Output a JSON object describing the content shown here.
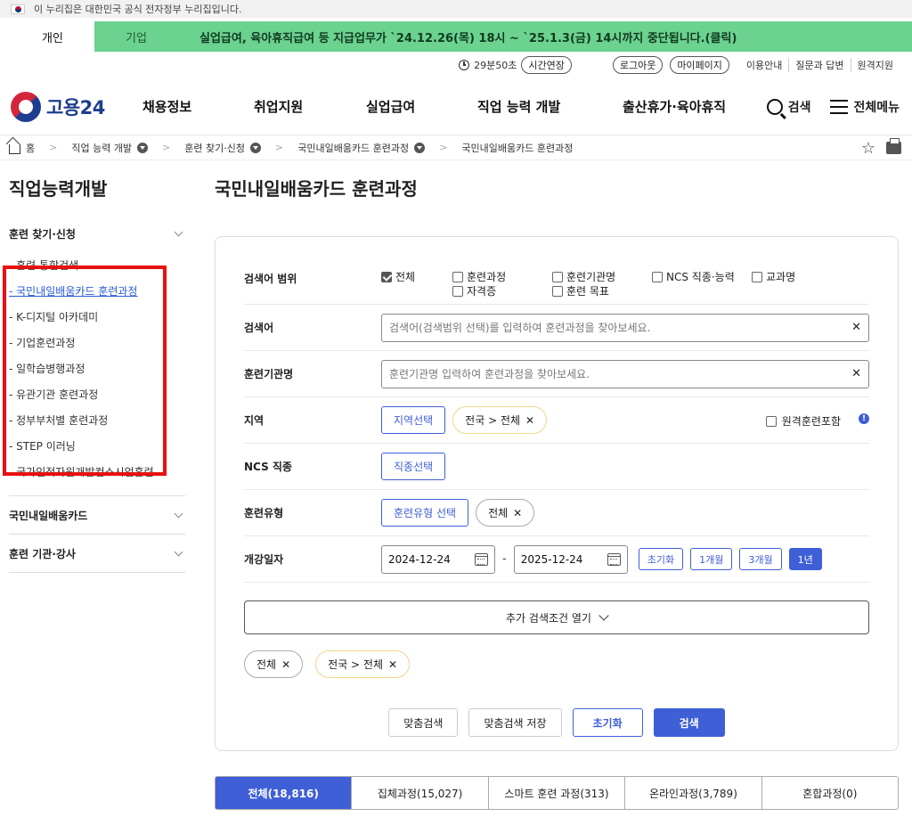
{
  "gov_banner": "이 누리집은 대한민국 공식 전자정부 누리집입니다.",
  "topbar": {
    "tabs": [
      "개인",
      "기업"
    ],
    "notice": "실업급여, 육아휴직급여 등 지급업무가 `24.12.26(목) 18시 ~ `25.1.3(금) 14시까지 중단됩니다.(클릭)"
  },
  "utility": {
    "timer": "29분50초",
    "extend": "시간연장",
    "logout": "로그아웃",
    "mypage": "마이페이지",
    "links": [
      "이용안내",
      "질문과 답변",
      "원격지원"
    ]
  },
  "gnb": {
    "logo": "고용24",
    "menu": [
      "채용정보",
      "취업지원",
      "실업급여",
      "직업 능력 개발",
      "출산휴가·육아휴직"
    ],
    "search": "검색",
    "all_menu": "전체메뉴"
  },
  "breadcrumb": {
    "home": "홈",
    "items": [
      "직업 능력 개발",
      "훈련 찾기·신청",
      "국민내일배움카드 훈련과정",
      "국민내일배움카드 훈련과정"
    ]
  },
  "sidebar": {
    "title": "직업능력개발",
    "group1": {
      "title": "훈련 찾기·신청",
      "items": [
        "- 훈련 통합검색",
        "- 국민내일배움카드 훈련과정",
        "- K-디지털 아카데미",
        "- 기업훈련과정",
        "- 일학습병행과정",
        "- 유관기관 훈련과정",
        "- 정부부처별 훈련과정",
        "- STEP 이러닝",
        "- 국가인적자원개발컨소시엄훈련"
      ]
    },
    "group2": "국민내일배움카드",
    "group3": "훈련 기관·강사"
  },
  "main": {
    "title": "국민내일배움카드 훈련과정",
    "scope": {
      "label": "검색어 범위",
      "options": [
        "전체",
        "훈련과정",
        "훈련기관명",
        "NCS 직종·능력",
        "교과명",
        "자격증",
        "훈련 목표"
      ]
    },
    "keyword": {
      "label": "검색어",
      "placeholder": "검색어(검색범위 선택)를 입력하여 훈련과정을 찾아보세요."
    },
    "institution": {
      "label": "훈련기관명",
      "placeholder": "훈련기관명 입력하여 훈련과정을 찾아보세요."
    },
    "region": {
      "label": "지역",
      "button": "지역선택",
      "chip": "전국 > 전체",
      "remote": "원격훈련포함"
    },
    "ncs": {
      "label": "NCS 직종",
      "button": "직종선택"
    },
    "type": {
      "label": "훈련유형",
      "button": "훈련유형 선택",
      "chip": "전체"
    },
    "date": {
      "label": "개강일자",
      "start": "2024-12-24",
      "separator": "-",
      "end": "2025-12-24",
      "buttons": [
        "초기화",
        "1개월",
        "3개월",
        "1년"
      ]
    },
    "more": "추가 검색조건 열기",
    "selected": [
      "전체",
      "전국 > 전체"
    ],
    "actions": [
      "맞춤검색",
      "맞춤검색 저장",
      "초기화",
      "검색"
    ]
  },
  "result_tabs": [
    "전체(18,816)",
    "집체과정(15,027)",
    "스마트 훈련 과정(313)",
    "온라인과정(3,789)",
    "혼합과정(0)"
  ],
  "colors": {
    "green": "#6bd28f",
    "primary": "#3f5fd7",
    "highlight": "#e81010"
  }
}
